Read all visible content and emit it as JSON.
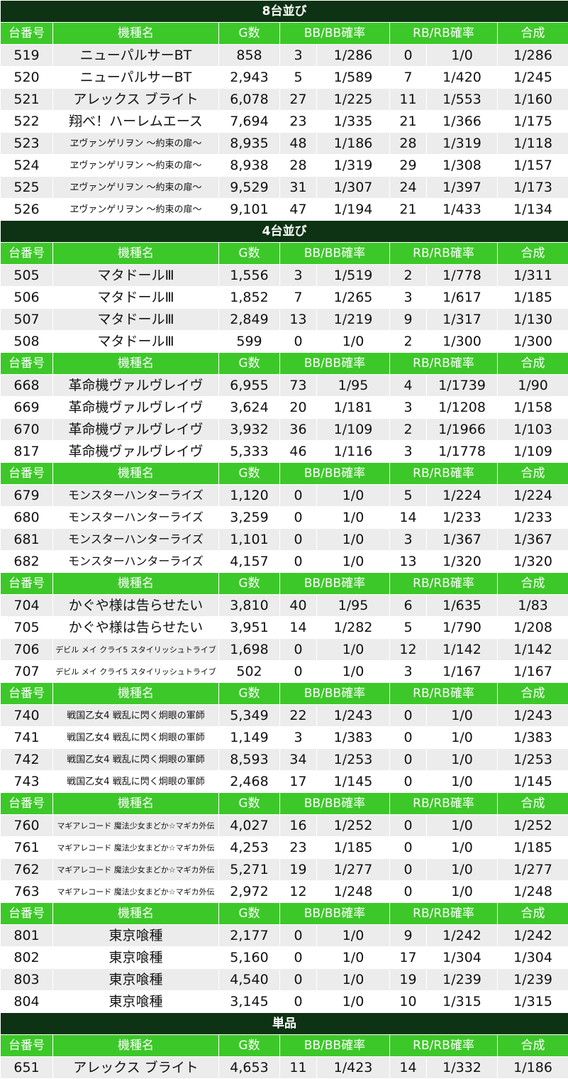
{
  "header_labels": [
    "台番号",
    "機種名",
    "G数",
    "BB/BB確率",
    "RB/RB確率",
    "合成"
  ],
  "sections": [
    {
      "title": "8台並び",
      "groups": [
        [
          [
            "519",
            "ニューパルサーBT",
            "858",
            "3",
            "1/286",
            "0",
            "1/0",
            "1/286"
          ],
          [
            "520",
            "ニューパルサーBT",
            "2,943",
            "5",
            "1/589",
            "7",
            "1/420",
            "1/245"
          ],
          [
            "521",
            "アレックス ブライト",
            "6,078",
            "27",
            "1/225",
            "11",
            "1/553",
            "1/160"
          ],
          [
            "522",
            "翔べ！ハーレムエース",
            "7,694",
            "23",
            "1/335",
            "21",
            "1/366",
            "1/175"
          ],
          [
            "523",
            "ヱヴァンゲリヲン ～約束の扉～",
            "8,935",
            "48",
            "1/186",
            "28",
            "1/319",
            "1/118"
          ],
          [
            "524",
            "ヱヴァンゲリヲン ～約束の扉～",
            "8,938",
            "28",
            "1/319",
            "29",
            "1/308",
            "1/157"
          ],
          [
            "525",
            "ヱヴァンゲリヲン ～約束の扉～",
            "9,529",
            "31",
            "1/307",
            "24",
            "1/397",
            "1/173"
          ],
          [
            "526",
            "ヱヴァンゲリヲン ～約束の扉～",
            "9,101",
            "47",
            "1/194",
            "21",
            "1/433",
            "1/134"
          ]
        ]
      ]
    },
    {
      "title": "4台並び",
      "groups": [
        [
          [
            "505",
            "マタドールⅢ",
            "1,556",
            "3",
            "1/519",
            "2",
            "1/778",
            "1/311"
          ],
          [
            "506",
            "マタドールⅢ",
            "1,852",
            "7",
            "1/265",
            "3",
            "1/617",
            "1/185"
          ],
          [
            "507",
            "マタドールⅢ",
            "2,849",
            "13",
            "1/219",
            "9",
            "1/317",
            "1/130"
          ],
          [
            "508",
            "マタドールⅢ",
            "599",
            "0",
            "1/0",
            "2",
            "1/300",
            "1/300"
          ]
        ],
        [
          [
            "668",
            "革命機ヴァルヴレイヴ",
            "6,955",
            "73",
            "1/95",
            "4",
            "1/1739",
            "1/90"
          ],
          [
            "669",
            "革命機ヴァルヴレイヴ",
            "3,624",
            "20",
            "1/181",
            "3",
            "1/1208",
            "1/158"
          ],
          [
            "670",
            "革命機ヴァルヴレイヴ",
            "3,932",
            "36",
            "1/109",
            "2",
            "1/1966",
            "1/103"
          ],
          [
            "817",
            "革命機ヴァルヴレイヴ",
            "5,333",
            "46",
            "1/116",
            "3",
            "1/1778",
            "1/109"
          ]
        ],
        [
          [
            "679",
            "モンスターハンターライズ",
            "1,120",
            "0",
            "1/0",
            "5",
            "1/224",
            "1/224"
          ],
          [
            "680",
            "モンスターハンターライズ",
            "3,259",
            "0",
            "1/0",
            "14",
            "1/233",
            "1/233"
          ],
          [
            "681",
            "モンスターハンターライズ",
            "1,101",
            "0",
            "1/0",
            "3",
            "1/367",
            "1/367"
          ],
          [
            "682",
            "モンスターハンターライズ",
            "4,157",
            "0",
            "1/0",
            "13",
            "1/320",
            "1/320"
          ]
        ],
        [
          [
            "704",
            "かぐや様は告らせたい",
            "3,810",
            "40",
            "1/95",
            "6",
            "1/635",
            "1/83"
          ],
          [
            "705",
            "かぐや様は告らせたい",
            "3,951",
            "14",
            "1/282",
            "5",
            "1/790",
            "1/208"
          ],
          [
            "706",
            "デビル メイ クライ5 スタイリッシュトライブ",
            "1,698",
            "0",
            "1/0",
            "12",
            "1/142",
            "1/142"
          ],
          [
            "707",
            "デビル メイ クライ5 スタイリッシュトライブ",
            "502",
            "0",
            "1/0",
            "3",
            "1/167",
            "1/167"
          ]
        ],
        [
          [
            "740",
            "戦国乙女4 戦乱に閃く炯眼の軍師",
            "5,349",
            "22",
            "1/243",
            "0",
            "1/0",
            "1/243"
          ],
          [
            "741",
            "戦国乙女4 戦乱に閃く炯眼の軍師",
            "1,149",
            "3",
            "1/383",
            "0",
            "1/0",
            "1/383"
          ],
          [
            "742",
            "戦国乙女4 戦乱に閃く炯眼の軍師",
            "8,593",
            "34",
            "1/253",
            "0",
            "1/0",
            "1/253"
          ],
          [
            "743",
            "戦国乙女4 戦乱に閃く炯眼の軍師",
            "2,468",
            "17",
            "1/145",
            "0",
            "1/0",
            "1/145"
          ]
        ],
        [
          [
            "760",
            "マギアレコード 魔法少女まどか☆マギカ外伝",
            "4,027",
            "16",
            "1/252",
            "0",
            "1/0",
            "1/252"
          ],
          [
            "761",
            "マギアレコード 魔法少女まどか☆マギカ外伝",
            "4,253",
            "23",
            "1/185",
            "0",
            "1/0",
            "1/185"
          ],
          [
            "762",
            "マギアレコード 魔法少女まどか☆マギカ外伝",
            "5,271",
            "19",
            "1/277",
            "0",
            "1/0",
            "1/277"
          ],
          [
            "763",
            "マギアレコード 魔法少女まどか☆マギカ外伝",
            "2,972",
            "12",
            "1/248",
            "0",
            "1/0",
            "1/248"
          ]
        ],
        [
          [
            "801",
            "東京喰種",
            "2,177",
            "0",
            "1/0",
            "9",
            "1/242",
            "1/242"
          ],
          [
            "802",
            "東京喰種",
            "5,160",
            "0",
            "1/0",
            "17",
            "1/304",
            "1/304"
          ],
          [
            "803",
            "東京喰種",
            "4,540",
            "0",
            "1/0",
            "19",
            "1/239",
            "1/239"
          ],
          [
            "804",
            "東京喰種",
            "3,145",
            "0",
            "1/0",
            "10",
            "1/315",
            "1/315"
          ]
        ]
      ]
    },
    {
      "title": "単品",
      "groups": [
        [
          [
            "651",
            "アレックス ブライト",
            "4,653",
            "11",
            "1/423",
            "14",
            "1/332",
            "1/186"
          ]
        ]
      ]
    }
  ]
}
